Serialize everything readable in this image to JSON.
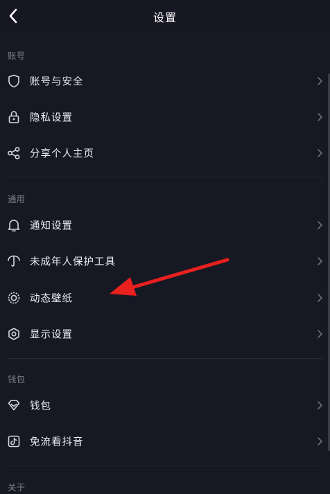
{
  "header": {
    "title": "设置"
  },
  "sections": [
    {
      "label": "账号"
    },
    {
      "label": "通用"
    },
    {
      "label": "钱包"
    },
    {
      "label": "关于"
    }
  ],
  "items": {
    "account_security": "账号与安全",
    "privacy": "隐私设置",
    "share_profile": "分享个人主页",
    "notification": "通知设置",
    "minor_protection": "未成年人保护工具",
    "live_wallpaper": "动态壁纸",
    "display": "显示设置",
    "wallet": "钱包",
    "free_data": "免流看抖音"
  },
  "colors": {
    "background": "#161823",
    "annotation_arrow": "#e8201e"
  }
}
